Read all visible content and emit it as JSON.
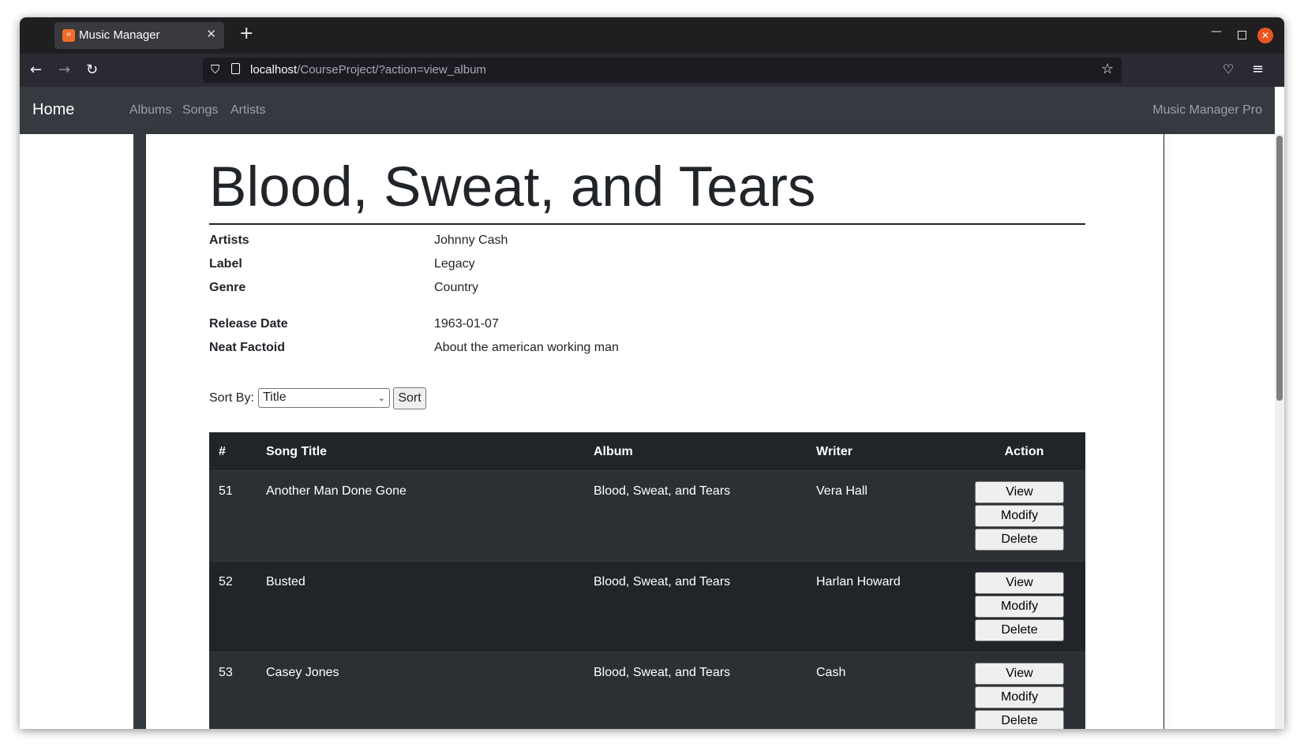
{
  "browser": {
    "tab_title": "Music Manager",
    "new_tab_symbol": "+",
    "url_host": "localhost",
    "url_path": "/CourseProject/?action=view_album"
  },
  "app": {
    "brand": "Home",
    "nav": [
      "Albums",
      "Songs",
      "Artists"
    ],
    "right_text": "Music Manager Pro"
  },
  "album": {
    "title": "Blood, Sweat, and Tears",
    "details": [
      {
        "label": "Artists",
        "value": "Johnny Cash"
      },
      {
        "label": "Label",
        "value": "Legacy"
      },
      {
        "label": "Genre",
        "value": "Country"
      },
      {
        "label": "Release Date",
        "value": "1963-01-07"
      },
      {
        "label": "Neat Factoid",
        "value": "About the american working man"
      }
    ]
  },
  "sort": {
    "label": "Sort By:",
    "selected": "Title",
    "button": "Sort"
  },
  "table": {
    "headers": [
      "#",
      "Song Title",
      "Album",
      "Writer",
      "Action"
    ],
    "rows": [
      {
        "num": "51",
        "title": "Another Man Done Gone",
        "album": "Blood, Sweat, and Tears",
        "writer": "Vera Hall"
      },
      {
        "num": "52",
        "title": "Busted",
        "album": "Blood, Sweat, and Tears",
        "writer": "Harlan Howard"
      },
      {
        "num": "53",
        "title": "Casey Jones",
        "album": "Blood, Sweat, and Tears",
        "writer": "Cash"
      }
    ],
    "actions": [
      "View",
      "Modify",
      "Delete"
    ]
  },
  "colors": {
    "navbar": "#343a40",
    "table_dark": "#212529",
    "table_stripe": "#2c3034"
  }
}
